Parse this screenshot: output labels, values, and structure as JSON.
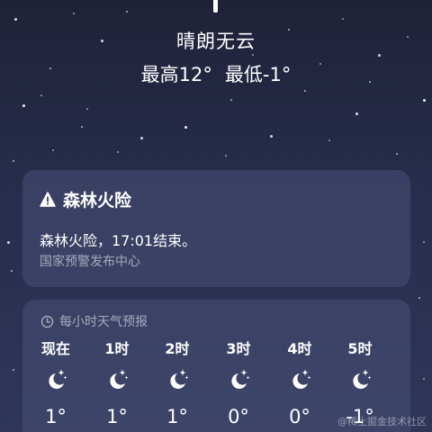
{
  "current": {
    "condition": "晴朗无云",
    "high": "最高12°",
    "low": "最低-1°"
  },
  "alert": {
    "icon": "warning-icon",
    "title": "森林火险",
    "message": "森林火险，17:01结束。",
    "source": "国家预警发布中心"
  },
  "hourly": {
    "icon": "clock-icon",
    "title": "每小时天气预报",
    "hours": [
      {
        "label": "现在",
        "icon": "moon-stars-icon",
        "temp": "1°"
      },
      {
        "label": "1时",
        "icon": "moon-stars-icon",
        "temp": "1°"
      },
      {
        "label": "2时",
        "icon": "moon-stars-icon",
        "temp": "1°"
      },
      {
        "label": "3时",
        "icon": "moon-stars-icon",
        "temp": "0°"
      },
      {
        "label": "4时",
        "icon": "moon-stars-icon",
        "temp": "0°"
      },
      {
        "label": "5时",
        "icon": "moon-stars-icon",
        "temp": "-1°"
      }
    ]
  },
  "watermark": "@稀土掘金技术社区",
  "colors": {
    "background_top": "#1f2238",
    "background_bottom": "#2f3658",
    "card": "#485076",
    "secondary_text": "#a9acbd"
  }
}
